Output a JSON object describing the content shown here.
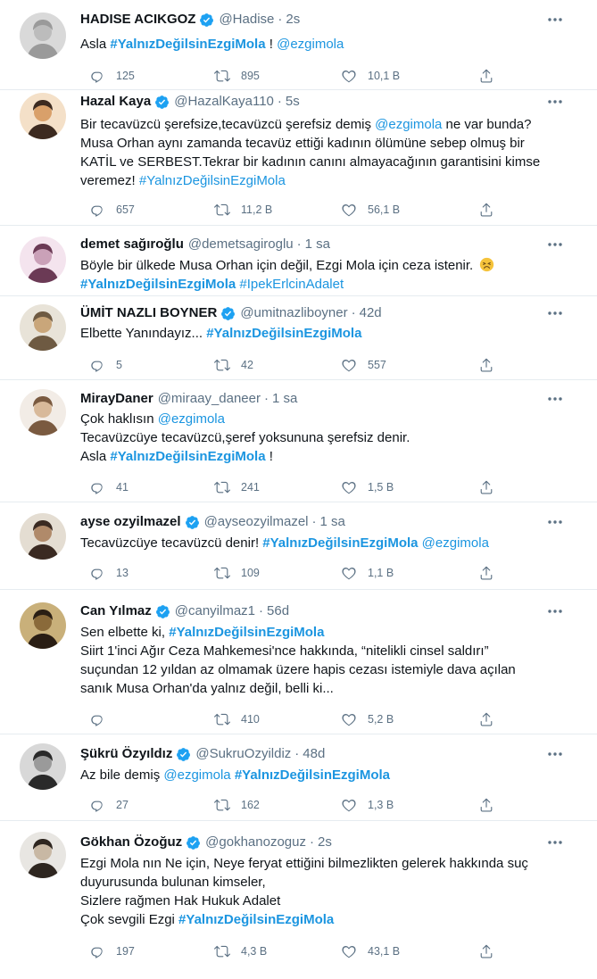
{
  "colors": {
    "link": "#1b95e0",
    "verified": "#1da1f2",
    "muted": "#5b7083",
    "divider": "#e6ecf0"
  },
  "tweets": [
    {
      "name": "HADISE ACIKGOZ",
      "verified": true,
      "handle": "@Hadise",
      "time": "2s",
      "lines": [
        [
          {
            "t": "text",
            "v": "Asla "
          },
          {
            "t": "tag",
            "v": "#YalnızDeğilsinEzgiMola"
          },
          {
            "t": "text",
            "v": " ! "
          },
          {
            "t": "link",
            "v": "@ezgimola"
          }
        ]
      ],
      "reply": "125",
      "retweet": "895",
      "like": "10,1 B"
    },
    {
      "name": "Hazal Kaya",
      "verified": true,
      "handle": "@HazalKaya110",
      "time": "5s",
      "lines": [
        [
          {
            "t": "text",
            "v": "Bir tecavüzcü şerefsize,tecavüzcü şerefsiz demiş "
          },
          {
            "t": "link",
            "v": "@ezgimola"
          },
          {
            "t": "text",
            "v": " ne var bunda?"
          }
        ],
        [
          {
            "t": "text",
            "v": "Musa Orhan aynı zamanda tecavüz ettiği kadının ölümüne sebep olmuş bir"
          }
        ],
        [
          {
            "t": "text",
            "v": "KATİL ve SERBEST.Tekrar bir kadının canını almayacağının garantisini kimse"
          }
        ],
        [
          {
            "t": "text",
            "v": "veremez! "
          },
          {
            "t": "link",
            "v": "#YalnızDeğilsinEzgiMola"
          }
        ]
      ],
      "reply": "657",
      "retweet": "11,2 B",
      "like": "56,1 B"
    },
    {
      "name": "demet sağıroğlu",
      "verified": false,
      "handle": "@demetsagiroglu",
      "time": "1 sa",
      "lines": [
        [
          {
            "t": "text",
            "v": "Böyle bir ülkede Musa Orhan için değil, Ezgi Mola için ceza istenir. "
          },
          {
            "t": "emoji",
            "v": "😣"
          }
        ],
        [
          {
            "t": "tag",
            "v": "#YalnızDeğilsinEzgiMola"
          },
          {
            "t": "text",
            "v": " "
          },
          {
            "t": "link",
            "v": "#IpekErlcinAdalet"
          }
        ]
      ],
      "reply": "",
      "retweet": "",
      "like": ""
    },
    {
      "name": "ÜMİT NAZLI BOYNER",
      "verified": true,
      "handle": "@umitnazliboyner",
      "time": "42d",
      "lines": [
        [
          {
            "t": "text",
            "v": "Elbette Yanındayız...  "
          },
          {
            "t": "tag",
            "v": "#YalnızDeğilsinEzgiMola"
          }
        ]
      ],
      "reply": "5",
      "retweet": "42",
      "like": "557"
    },
    {
      "name": "MirayDaner",
      "verified": false,
      "handle": "@miraay_daneer",
      "time": "1 sa",
      "lines": [
        [
          {
            "t": "text",
            "v": "Çok haklısın "
          },
          {
            "t": "link",
            "v": "@ezgimola"
          }
        ],
        [
          {
            "t": "text",
            "v": "Tecavüzcüye tecavüzcü,şeref yoksununa şerefsiz denir."
          }
        ],
        [
          {
            "t": "text",
            "v": "Asla "
          },
          {
            "t": "tag",
            "v": "#YalnızDeğilsinEzgiMola"
          },
          {
            "t": "text",
            "v": " !"
          }
        ]
      ],
      "reply": "41",
      "retweet": "241",
      "like": "1,5 B"
    },
    {
      "name": "ayse ozyilmazel",
      "verified": true,
      "handle": "@ayseozyilmazel",
      "time": "1 sa",
      "lines": [
        [
          {
            "t": "text",
            "v": "Tecavüzcüye tecavüzcü denir! "
          },
          {
            "t": "tag",
            "v": "#YalnızDeğilsinEzgiMola"
          },
          {
            "t": "text",
            "v": " "
          },
          {
            "t": "link",
            "v": "@ezgimola"
          }
        ]
      ],
      "reply": "13",
      "retweet": "109",
      "like": "1,1 B"
    },
    {
      "name": "Can Yılmaz",
      "verified": true,
      "handle": "@canyilmaz1",
      "time": "56d",
      "lines": [
        [
          {
            "t": "text",
            "v": "Sen elbette ki, "
          },
          {
            "t": "tag",
            "v": "#YalnızDeğilsinEzgiMola"
          }
        ],
        [
          {
            "t": "text",
            "v": "Siirt 1'inci Ağır Ceza Mahkemesi'nce hakkında, “nitelikli cinsel saldırı”"
          }
        ],
        [
          {
            "t": "text",
            "v": "suçundan 12 yıldan az olmamak üzere hapis cezası istemiyle dava açılan"
          }
        ],
        [
          {
            "t": "text",
            "v": "sanık Musa Orhan'da yalnız değil, belli ki..."
          }
        ]
      ],
      "reply": "",
      "retweet": "410",
      "like": "5,2 B"
    },
    {
      "name": "Şükrü Özyıldız",
      "verified": true,
      "handle": "@SukruOzyildiz",
      "time": "48d",
      "lines": [
        [
          {
            "t": "text",
            "v": "Az bile demiş "
          },
          {
            "t": "link",
            "v": "@ezgimola"
          },
          {
            "t": "text",
            "v": " "
          },
          {
            "t": "tag",
            "v": "#YalnızDeğilsinEzgiMola"
          }
        ]
      ],
      "reply": "27",
      "retweet": "162",
      "like": "1,3 B"
    },
    {
      "name": "Gökhan Özoğuz",
      "verified": true,
      "handle": "@gokhanozoguz",
      "time": "2s",
      "lines": [
        [
          {
            "t": "text",
            "v": "Ezgi Mola nın Ne için, Neye feryat ettiğini bilmezlikten gelerek hakkında suç"
          }
        ],
        [
          {
            "t": "text",
            "v": "duyurusunda bulunan kimseler,"
          }
        ],
        [
          {
            "t": "text",
            "v": "Sizlere rağmen Hak Hukuk Adalet"
          }
        ],
        [
          {
            "t": "text",
            "v": "Çok sevgili Ezgi "
          },
          {
            "t": "tag",
            "v": "#YalnızDeğilsinEzgiMola"
          }
        ]
      ],
      "reply": "197",
      "retweet": "4,3 B",
      "like": "43,1 B"
    }
  ]
}
